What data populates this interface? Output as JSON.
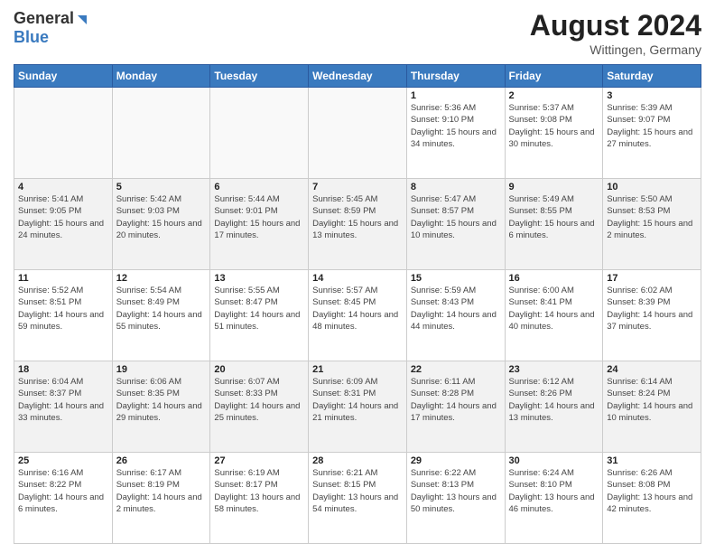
{
  "logo": {
    "general": "General",
    "blue": "Blue"
  },
  "title": {
    "month_year": "August 2024",
    "location": "Wittingen, Germany"
  },
  "days_of_week": [
    "Sunday",
    "Monday",
    "Tuesday",
    "Wednesday",
    "Thursday",
    "Friday",
    "Saturday"
  ],
  "weeks": [
    [
      {
        "day": "",
        "info": ""
      },
      {
        "day": "",
        "info": ""
      },
      {
        "day": "",
        "info": ""
      },
      {
        "day": "",
        "info": ""
      },
      {
        "day": "1",
        "info": "Sunrise: 5:36 AM\nSunset: 9:10 PM\nDaylight: 15 hours and 34 minutes."
      },
      {
        "day": "2",
        "info": "Sunrise: 5:37 AM\nSunset: 9:08 PM\nDaylight: 15 hours and 30 minutes."
      },
      {
        "day": "3",
        "info": "Sunrise: 5:39 AM\nSunset: 9:07 PM\nDaylight: 15 hours and 27 minutes."
      }
    ],
    [
      {
        "day": "4",
        "info": "Sunrise: 5:41 AM\nSunset: 9:05 PM\nDaylight: 15 hours and 24 minutes."
      },
      {
        "day": "5",
        "info": "Sunrise: 5:42 AM\nSunset: 9:03 PM\nDaylight: 15 hours and 20 minutes."
      },
      {
        "day": "6",
        "info": "Sunrise: 5:44 AM\nSunset: 9:01 PM\nDaylight: 15 hours and 17 minutes."
      },
      {
        "day": "7",
        "info": "Sunrise: 5:45 AM\nSunset: 8:59 PM\nDaylight: 15 hours and 13 minutes."
      },
      {
        "day": "8",
        "info": "Sunrise: 5:47 AM\nSunset: 8:57 PM\nDaylight: 15 hours and 10 minutes."
      },
      {
        "day": "9",
        "info": "Sunrise: 5:49 AM\nSunset: 8:55 PM\nDaylight: 15 hours and 6 minutes."
      },
      {
        "day": "10",
        "info": "Sunrise: 5:50 AM\nSunset: 8:53 PM\nDaylight: 15 hours and 2 minutes."
      }
    ],
    [
      {
        "day": "11",
        "info": "Sunrise: 5:52 AM\nSunset: 8:51 PM\nDaylight: 14 hours and 59 minutes."
      },
      {
        "day": "12",
        "info": "Sunrise: 5:54 AM\nSunset: 8:49 PM\nDaylight: 14 hours and 55 minutes."
      },
      {
        "day": "13",
        "info": "Sunrise: 5:55 AM\nSunset: 8:47 PM\nDaylight: 14 hours and 51 minutes."
      },
      {
        "day": "14",
        "info": "Sunrise: 5:57 AM\nSunset: 8:45 PM\nDaylight: 14 hours and 48 minutes."
      },
      {
        "day": "15",
        "info": "Sunrise: 5:59 AM\nSunset: 8:43 PM\nDaylight: 14 hours and 44 minutes."
      },
      {
        "day": "16",
        "info": "Sunrise: 6:00 AM\nSunset: 8:41 PM\nDaylight: 14 hours and 40 minutes."
      },
      {
        "day": "17",
        "info": "Sunrise: 6:02 AM\nSunset: 8:39 PM\nDaylight: 14 hours and 37 minutes."
      }
    ],
    [
      {
        "day": "18",
        "info": "Sunrise: 6:04 AM\nSunset: 8:37 PM\nDaylight: 14 hours and 33 minutes."
      },
      {
        "day": "19",
        "info": "Sunrise: 6:06 AM\nSunset: 8:35 PM\nDaylight: 14 hours and 29 minutes."
      },
      {
        "day": "20",
        "info": "Sunrise: 6:07 AM\nSunset: 8:33 PM\nDaylight: 14 hours and 25 minutes."
      },
      {
        "day": "21",
        "info": "Sunrise: 6:09 AM\nSunset: 8:31 PM\nDaylight: 14 hours and 21 minutes."
      },
      {
        "day": "22",
        "info": "Sunrise: 6:11 AM\nSunset: 8:28 PM\nDaylight: 14 hours and 17 minutes."
      },
      {
        "day": "23",
        "info": "Sunrise: 6:12 AM\nSunset: 8:26 PM\nDaylight: 14 hours and 13 minutes."
      },
      {
        "day": "24",
        "info": "Sunrise: 6:14 AM\nSunset: 8:24 PM\nDaylight: 14 hours and 10 minutes."
      }
    ],
    [
      {
        "day": "25",
        "info": "Sunrise: 6:16 AM\nSunset: 8:22 PM\nDaylight: 14 hours and 6 minutes."
      },
      {
        "day": "26",
        "info": "Sunrise: 6:17 AM\nSunset: 8:19 PM\nDaylight: 14 hours and 2 minutes."
      },
      {
        "day": "27",
        "info": "Sunrise: 6:19 AM\nSunset: 8:17 PM\nDaylight: 13 hours and 58 minutes."
      },
      {
        "day": "28",
        "info": "Sunrise: 6:21 AM\nSunset: 8:15 PM\nDaylight: 13 hours and 54 minutes."
      },
      {
        "day": "29",
        "info": "Sunrise: 6:22 AM\nSunset: 8:13 PM\nDaylight: 13 hours and 50 minutes."
      },
      {
        "day": "30",
        "info": "Sunrise: 6:24 AM\nSunset: 8:10 PM\nDaylight: 13 hours and 46 minutes."
      },
      {
        "day": "31",
        "info": "Sunrise: 6:26 AM\nSunset: 8:08 PM\nDaylight: 13 hours and 42 minutes."
      }
    ]
  ]
}
